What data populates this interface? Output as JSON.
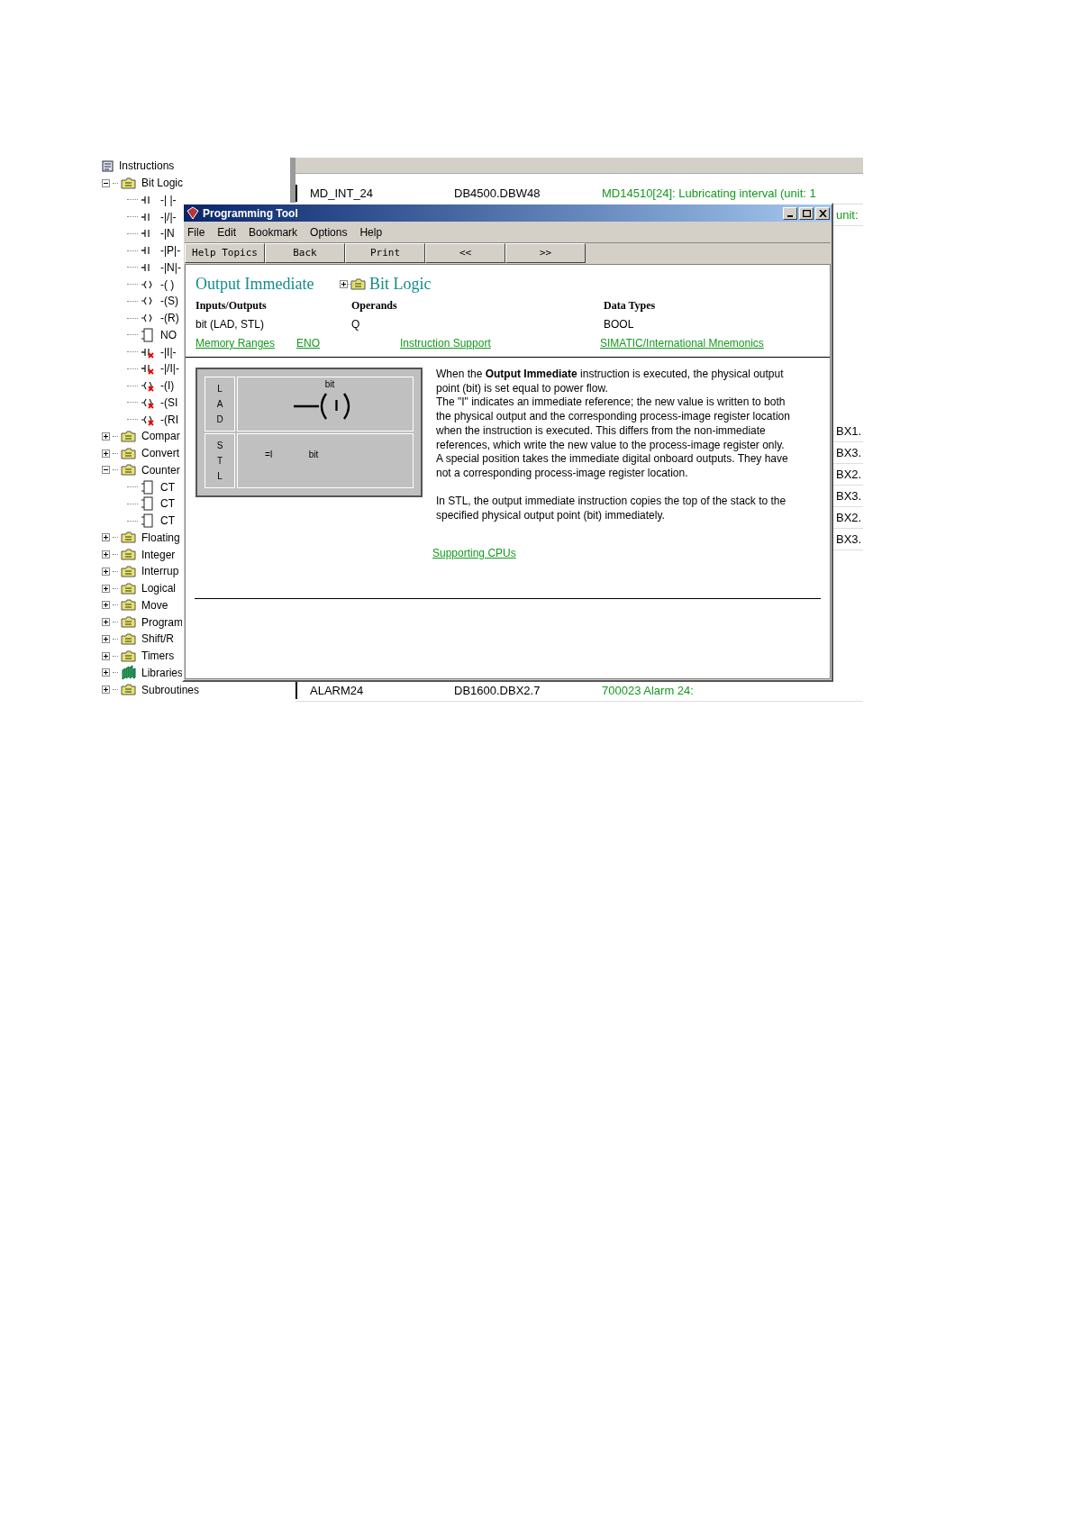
{
  "tree": [
    {
      "label": "Instructions",
      "kind": "root",
      "children": [
        {
          "label": "Bit Logic",
          "kind": "folder",
          "expanded": true,
          "children": [
            {
              "label": "-| |-",
              "kind": "contact"
            },
            {
              "label": "-|/|-",
              "kind": "contact"
            },
            {
              "label": "-|N",
              "kind": "contact"
            },
            {
              "label": "-|P|-",
              "kind": "contact"
            },
            {
              "label": "-|N|-",
              "kind": "contact"
            },
            {
              "label": "-( )",
              "kind": "coil"
            },
            {
              "label": "-(S)",
              "kind": "coil"
            },
            {
              "label": "-(R)",
              "kind": "coil"
            },
            {
              "label": "NO",
              "kind": "box"
            },
            {
              "label": "-|I|-",
              "kind": "contact_immediate"
            },
            {
              "label": "-|/I|-",
              "kind": "contact_immediate"
            },
            {
              "label": "-(I)",
              "kind": "coil_immediate"
            },
            {
              "label": "-(SI",
              "kind": "coil_immediate"
            },
            {
              "label": "-(RI",
              "kind": "coil_immediate"
            }
          ]
        },
        {
          "label": "Compar",
          "kind": "folder",
          "expanded": false
        },
        {
          "label": "Convert",
          "kind": "folder",
          "expanded": false
        },
        {
          "label": "Counter",
          "kind": "folder",
          "expanded": true,
          "children": [
            {
              "label": "CT",
              "kind": "box"
            },
            {
              "label": "CT",
              "kind": "box"
            },
            {
              "label": "CT",
              "kind": "box"
            }
          ]
        },
        {
          "label": "Floating",
          "kind": "folder",
          "expanded": false
        },
        {
          "label": "Integer",
          "kind": "folder",
          "expanded": false
        },
        {
          "label": "Interrup",
          "kind": "folder",
          "expanded": false
        },
        {
          "label": "Logical",
          "kind": "folder",
          "expanded": false
        },
        {
          "label": "Move",
          "kind": "folder",
          "expanded": false
        },
        {
          "label": "Program",
          "kind": "folder",
          "expanded": false
        },
        {
          "label": "Shift/R",
          "kind": "folder",
          "expanded": false
        },
        {
          "label": "Timers",
          "kind": "folder",
          "expanded": false
        },
        {
          "label": "Libraries",
          "kind": "library",
          "expanded": false
        },
        {
          "label": "Subroutines",
          "kind": "folder",
          "expanded": false
        }
      ]
    }
  ],
  "background_table": {
    "rows": [
      {
        "cells": [
          "MD_INT_24",
          "DB4500.DBW48",
          "MD14510[24]: Lubricating interval  (unit: 1"
        ]
      },
      {
        "tail": "unit:"
      },
      {
        "tail": "BX1."
      },
      {
        "tail": "BX3."
      },
      {
        "tail": "BX2."
      },
      {
        "tail": "BX3."
      },
      {
        "tail": "BX2."
      },
      {
        "tail": "BX3."
      },
      {
        "cells": [
          "ALARM24",
          "DB1600.DBX2.7",
          "700023  Alarm 24:"
        ]
      }
    ]
  },
  "dialog": {
    "title": "Programming Tool",
    "menu": [
      "File",
      "Edit",
      "Bookmark",
      "Options",
      "Help"
    ],
    "toolbar": [
      "Help Topics",
      "Back",
      "Print",
      "<<",
      ">>"
    ],
    "heading": "Output Immediate",
    "category": "Bit Logic",
    "columns": [
      {
        "header": "Inputs/Outputs",
        "value": "bit (LAD, STL)"
      },
      {
        "header": "Operands",
        "value": "Q"
      },
      {
        "header": "Data Types",
        "value": "BOOL"
      }
    ],
    "links": [
      "Memory Ranges",
      "ENO",
      "Instruction Support",
      "SIMATIC/International Mnemonics"
    ],
    "diagram": {
      "lad_label": "LAD",
      "lad_operand": "bit",
      "lad_symbol": "I",
      "stl_label": "STL",
      "stl_instruction": "=I",
      "stl_operand": "bit"
    },
    "description": [
      "When the **Output Immediate** instruction is executed, the physical output point (bit) is set equal to power flow.",
      "The \"I\" indicates an immediate reference; the new value is written to both the physical output and the corresponding process-image register location when the instruction is executed. This differs from the non-immediate references, which write the new value to the process-image register only.",
      "A special position takes the immediate digital onboard outputs. They have not a corresponding process-image register location.",
      "In STL, the output immediate instruction copies the top of the stack to the specified physical output point (bit) immediately."
    ],
    "supporting_link": "Supporting CPUs"
  }
}
